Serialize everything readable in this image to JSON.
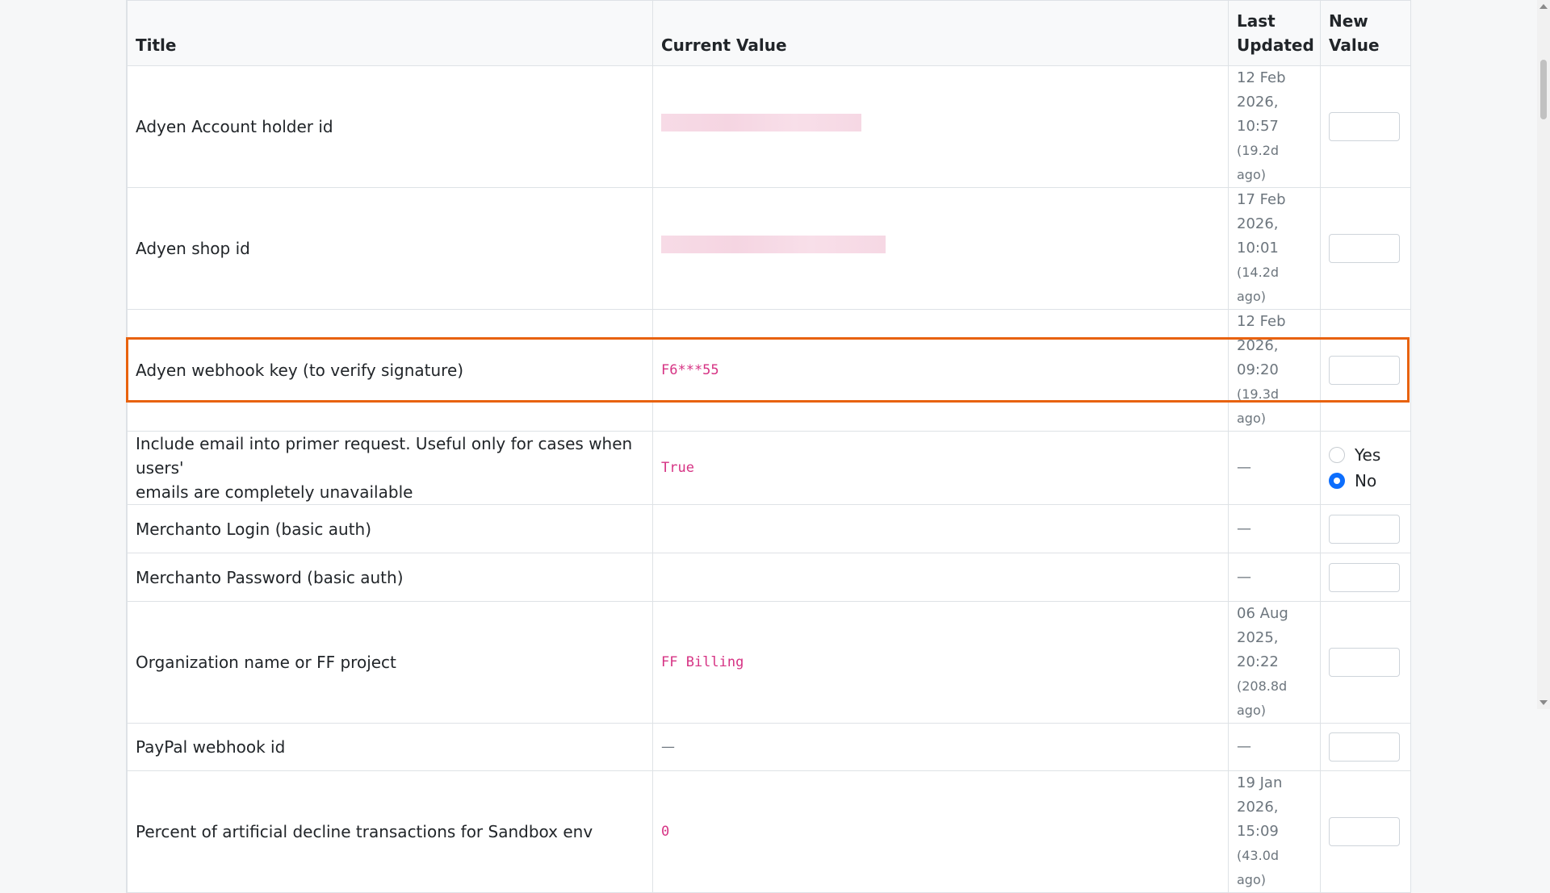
{
  "table": {
    "headers": {
      "title": "Title",
      "current_value": "Current Value",
      "last_updated_line1": "Last",
      "last_updated_line2": "Updated",
      "new_value_line1": "New",
      "new_value_line2": "Value"
    },
    "rows": [
      {
        "title": "Adyen Account holder id",
        "current_value": "",
        "current_redacted": true,
        "updated_line1": "12 Feb",
        "updated_line2": "2026, 10:57",
        "updated_ago": "(19.2d ago)"
      },
      {
        "title": "Adyen shop id",
        "current_value": "",
        "current_redacted": true,
        "updated_line1": "17 Feb",
        "updated_line2": "2026, 10:01",
        "updated_ago": "(14.2d ago)"
      },
      {
        "title": "Adyen webhook key (to verify signature)",
        "current_value": "F6***55",
        "updated_line1": "12 Feb",
        "updated_line2": "2026, 09:20",
        "updated_ago": "(19.3d ago)"
      },
      {
        "title_line1": "Include email into primer request. Useful only for cases when users'",
        "title_line2": "emails are completely unavailable",
        "current_value": "True",
        "updated": "—",
        "radio": {
          "yes_label": "Yes",
          "no_label": "No",
          "selected": "No"
        }
      },
      {
        "title": "Merchanto Login (basic auth)",
        "current_value": "",
        "updated": "—"
      },
      {
        "title": "Merchanto Password (basic auth)",
        "current_value": "",
        "updated": "—"
      },
      {
        "title": "Organization name or FF project",
        "current_value": "FF Billing",
        "updated_line1": "06 Aug",
        "updated_line2": "2025, 20:22",
        "updated_ago": "(208.8d ago)"
      },
      {
        "title": "PayPal webhook id",
        "current_value": "—",
        "updated": "—"
      },
      {
        "title": "Percent of artificial decline transactions for Sandbox env",
        "current_value": "0",
        "updated_line1": "19 Jan",
        "updated_line2": "2026, 15:09",
        "updated_ago": "(43.0d ago)"
      }
    ]
  },
  "colors": {
    "highlight": "#e8620e",
    "code_text": "#d63384",
    "radio_selected": "#0d6efd"
  }
}
